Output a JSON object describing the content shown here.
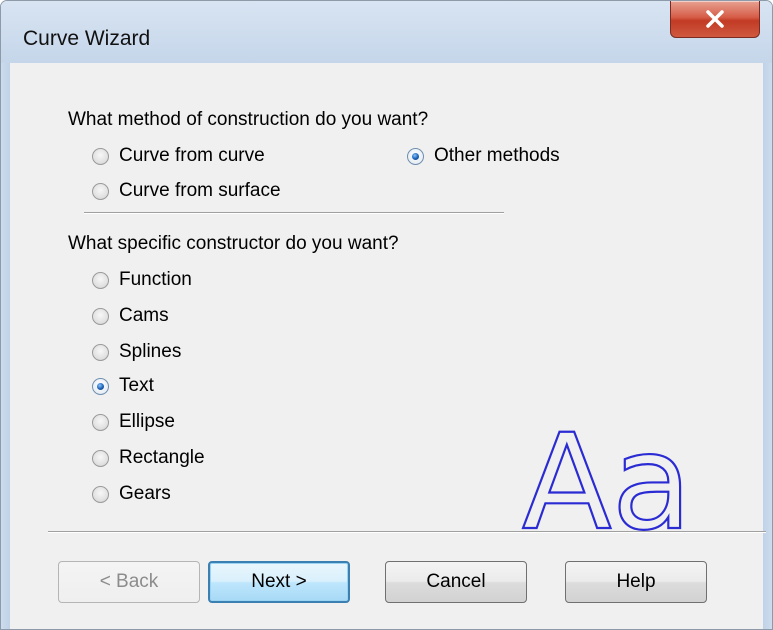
{
  "window": {
    "title": "Curve Wizard",
    "close_icon": "close-x-icon",
    "accent_color": "#3c7fb1"
  },
  "method_section": {
    "question": "What method of construction do you want?",
    "options": [
      {
        "label": "Curve from curve",
        "checked": false
      },
      {
        "label": "Other methods",
        "checked": true
      },
      {
        "label": "Curve from surface",
        "checked": false
      }
    ]
  },
  "constructor_section": {
    "question": "What specific constructor do you want?",
    "options": [
      {
        "label": "Function",
        "checked": false
      },
      {
        "label": "Cams",
        "checked": false
      },
      {
        "label": "Splines",
        "checked": false
      },
      {
        "label": "Text",
        "checked": true
      },
      {
        "label": "Ellipse",
        "checked": false
      },
      {
        "label": "Rectangle",
        "checked": false
      },
      {
        "label": "Gears",
        "checked": false
      }
    ]
  },
  "preview": {
    "text": "Aa",
    "color": "#2b2bd4"
  },
  "buttons": {
    "back": "< Back",
    "next": "Next >",
    "cancel": "Cancel",
    "help": "Help"
  }
}
